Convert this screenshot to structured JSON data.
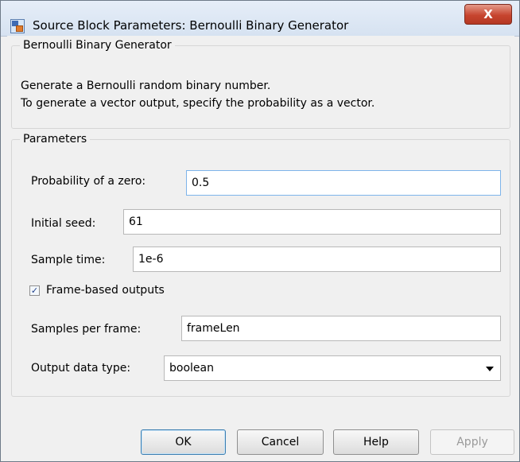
{
  "window": {
    "title": "Source Block Parameters: Bernoulli Binary Generator",
    "close_label": "X"
  },
  "block_group": {
    "legend": "Bernoulli Binary Generator",
    "description_line1": "Generate a Bernoulli random binary number.",
    "description_line2": "To generate a vector output, specify the probability as a vector."
  },
  "parameters": {
    "legend": "Parameters",
    "probability_zero": {
      "label": "Probability of a zero:",
      "value": "0.5"
    },
    "initial_seed": {
      "label": "Initial seed:",
      "value": "61"
    },
    "sample_time": {
      "label": "Sample time:",
      "value": "1e-6"
    },
    "frame_based": {
      "label": "Frame-based outputs",
      "checked": true,
      "check_glyph": "✓"
    },
    "samples_per_frame": {
      "label": "Samples per frame:",
      "value": "frameLen"
    },
    "output_data_type": {
      "label": "Output data type:",
      "value": "boolean"
    }
  },
  "buttons": {
    "ok": "OK",
    "cancel": "Cancel",
    "help": "Help",
    "apply": "Apply"
  },
  "colors": {
    "close_button": "#c7452f",
    "focus_border": "#7eb4ea"
  }
}
